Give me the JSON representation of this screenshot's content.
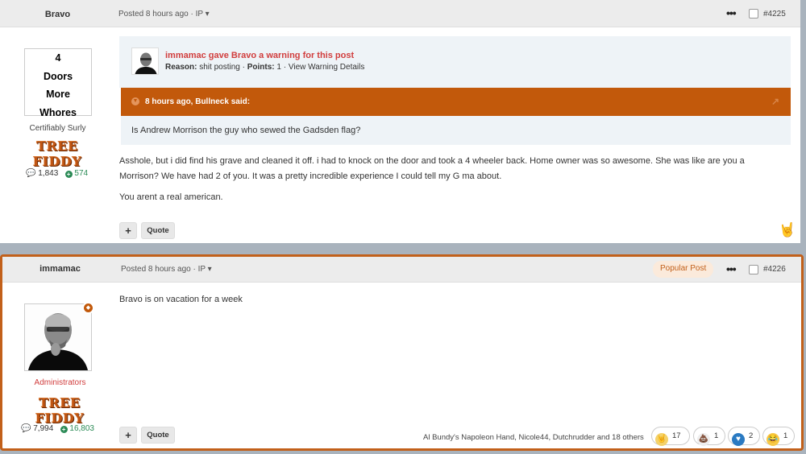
{
  "post1": {
    "author": "Bravo",
    "posted": "Posted 8 hours ago · IP ▾",
    "number": "#4225",
    "avatar_lines": [
      "4",
      "Doors",
      "More",
      "Whores"
    ],
    "title": "Certifiably Surly",
    "badge": "TREE FIDDY",
    "posts_count": "1,843",
    "reputation": "574",
    "warning": {
      "title": "immamac gave Bravo a warning for this post",
      "reason_label": "Reason:",
      "reason": "shit posting",
      "sep1": "·",
      "points_label": "Points:",
      "points": "1",
      "sep2": "·",
      "details_link": "View Warning Details"
    },
    "quote": {
      "header": "8 hours ago, Bullneck said:",
      "body": "Is Andrew Morrison the guy who sewed the Gadsden flag?"
    },
    "body_lines": [
      "Asshole, but i did find his grave and cleaned it off. i had to knock on the door and took a 4 wheeler back. Home owner was so awesome. She was like are you a",
      "Morrison? We have had 2 of you. It was a pretty incredible experience I could tell my G ma about.",
      "You arent a real american."
    ],
    "plus_label": "+",
    "quote_label": "Quote"
  },
  "post2": {
    "author": "immamac",
    "posted": "Posted 8 hours ago · IP ▾",
    "popular": "Popular Post",
    "number": "#4226",
    "role": "Administrators",
    "badge": "TREE FIDDY",
    "posts_count": "7,994",
    "reputation": "16,803",
    "body": "Bravo is on vacation for a week",
    "plus_label": "+",
    "quote_label": "Quote",
    "reactions_text": "Al Bundy's Napoleon Hand, Nicole44, Dutchrudder and 18 others",
    "reactions": [
      {
        "icon": "rock-on-icon",
        "count": "17"
      },
      {
        "icon": "poop-icon",
        "count": "1"
      },
      {
        "icon": "heart-icon",
        "count": "2"
      },
      {
        "icon": "laugh-icon",
        "count": "1"
      }
    ]
  },
  "colors": {
    "accent": "#c2590b",
    "warning_red": "#d13d3d",
    "reputation_green": "#2a8a55"
  }
}
